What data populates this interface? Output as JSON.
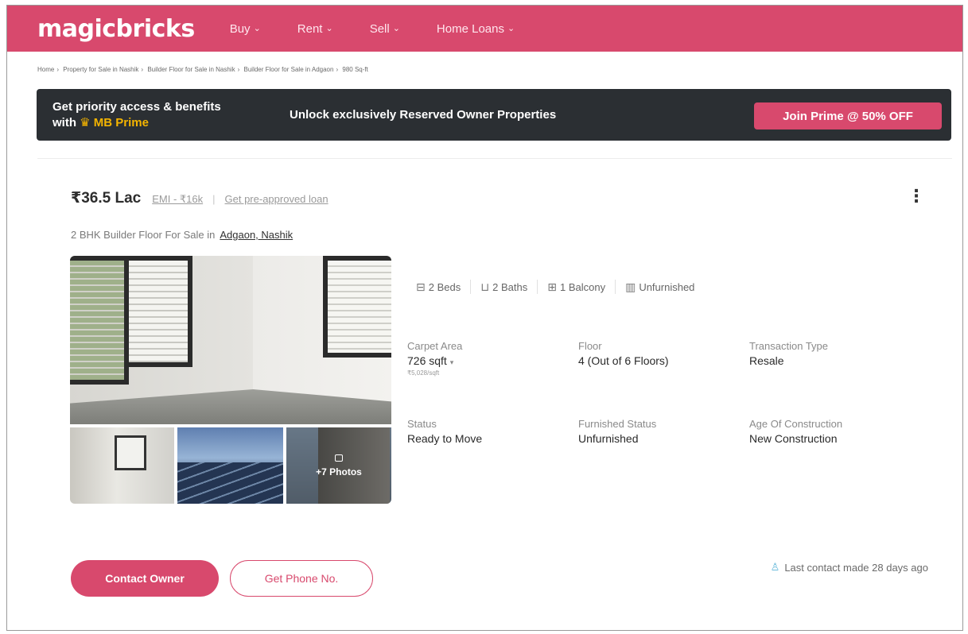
{
  "nav": {
    "logo": "magicbricks",
    "items": [
      {
        "label": "Buy"
      },
      {
        "label": "Rent"
      },
      {
        "label": "Sell"
      },
      {
        "label": "Home Loans"
      }
    ]
  },
  "breadcrumb": [
    "Home",
    "Property for Sale in Nashik",
    "Builder Floor for Sale in Nashik",
    "Builder Floor for Sale in Adgaon",
    "980 Sq-ft"
  ],
  "prime": {
    "line1": "Get priority access & benefits",
    "with": "with",
    "crown": "♛",
    "brand": "MB Prime",
    "message": "Unlock exclusively Reserved Owner Properties",
    "cta": "Join Prime @ 50% OFF"
  },
  "listing": {
    "price": "₹36.5 Lac",
    "emi": "EMI - ₹16k",
    "separator": "|",
    "loan_link": "Get pre-approved loan",
    "title_prefix": "2 BHK Builder Floor For Sale in",
    "location": "Adgaon, Nashik",
    "photos_label": "+7 Photos",
    "amenities": [
      {
        "icon": "bed-icon",
        "label": "2 Beds"
      },
      {
        "icon": "bath-icon",
        "label": "2 Baths"
      },
      {
        "icon": "balcony-icon",
        "label": "1 Balcony"
      },
      {
        "icon": "furnishing-icon",
        "label": "Unfurnished"
      }
    ],
    "specs": {
      "carpet_area": {
        "key": "Carpet Area",
        "value": "726 sqft",
        "sub": "₹5,028/sqft"
      },
      "floor": {
        "key": "Floor",
        "value": "4 (Out of 6 Floors)"
      },
      "transaction": {
        "key": "Transaction Type",
        "value": "Resale"
      },
      "status": {
        "key": "Status",
        "value": "Ready to Move"
      },
      "furnished": {
        "key": "Furnished Status",
        "value": "Unfurnished"
      },
      "age": {
        "key": "Age Of Construction",
        "value": "New Construction"
      }
    },
    "contact_cta": "Contact Owner",
    "phone_cta": "Get Phone No.",
    "last_contact": "Last contact made 28 days ago"
  },
  "colors": {
    "brand": "#d8496d",
    "banner_bg": "#2b2f33",
    "prime_gold": "#f4b400",
    "contact_icon": "#5fb6d9"
  }
}
